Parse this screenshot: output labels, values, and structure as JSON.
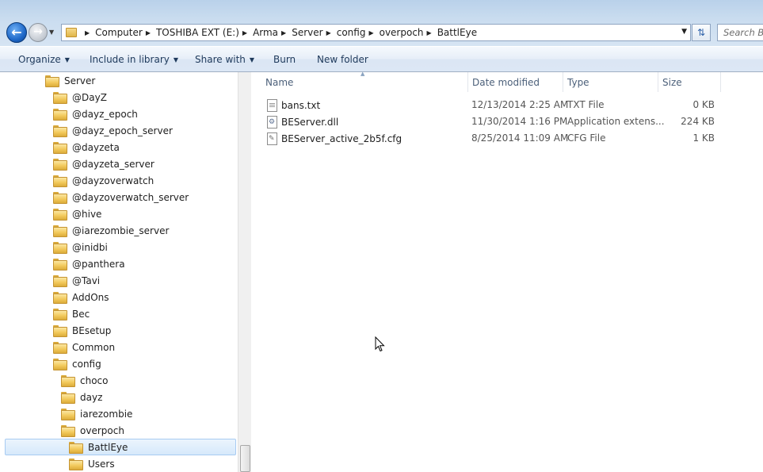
{
  "address": {
    "crumbs": [
      "Computer",
      "TOSHIBA EXT (E:)",
      "Arma",
      "Server",
      "config",
      "overpoch",
      "BattlEye"
    ]
  },
  "search": {
    "placeholder": "Search BattlEye"
  },
  "toolbar": {
    "organize": "Organize",
    "include_in_library": "Include in library",
    "share_with": "Share with",
    "burn": "Burn",
    "new_folder": "New folder"
  },
  "nav_tree": [
    "Server",
    "@DayZ",
    "@dayz_epoch",
    "@dayz_epoch_server",
    "@dayzeta",
    "@dayzeta_server",
    "@dayzoverwatch",
    "@dayzoverwatch_server",
    "@hive",
    "@iarezombie_server",
    "@inidbi",
    "@panthera",
    "@Tavi",
    "AddOns",
    "Bec",
    "BEsetup",
    "Common",
    "config",
    "choco",
    "dayz",
    "iarezombie",
    "overpoch",
    "BattlEye",
    "Users"
  ],
  "columns": {
    "name": "Name",
    "date": "Date modified",
    "type": "Type",
    "size": "Size"
  },
  "files": [
    {
      "name": "bans.txt",
      "date": "12/13/2014 2:25 AM",
      "type": "TXT File",
      "size": "0 KB",
      "icon": "text-file-icon"
    },
    {
      "name": "BEServer.dll",
      "date": "11/30/2014 1:16 PM",
      "type": "Application extens...",
      "size": "224 KB",
      "icon": "dll-file-icon"
    },
    {
      "name": "BEServer_active_2b5f.cfg",
      "date": "8/25/2014 11:09 AM",
      "type": "CFG File",
      "size": "1 KB",
      "icon": "cfg-file-icon"
    }
  ]
}
